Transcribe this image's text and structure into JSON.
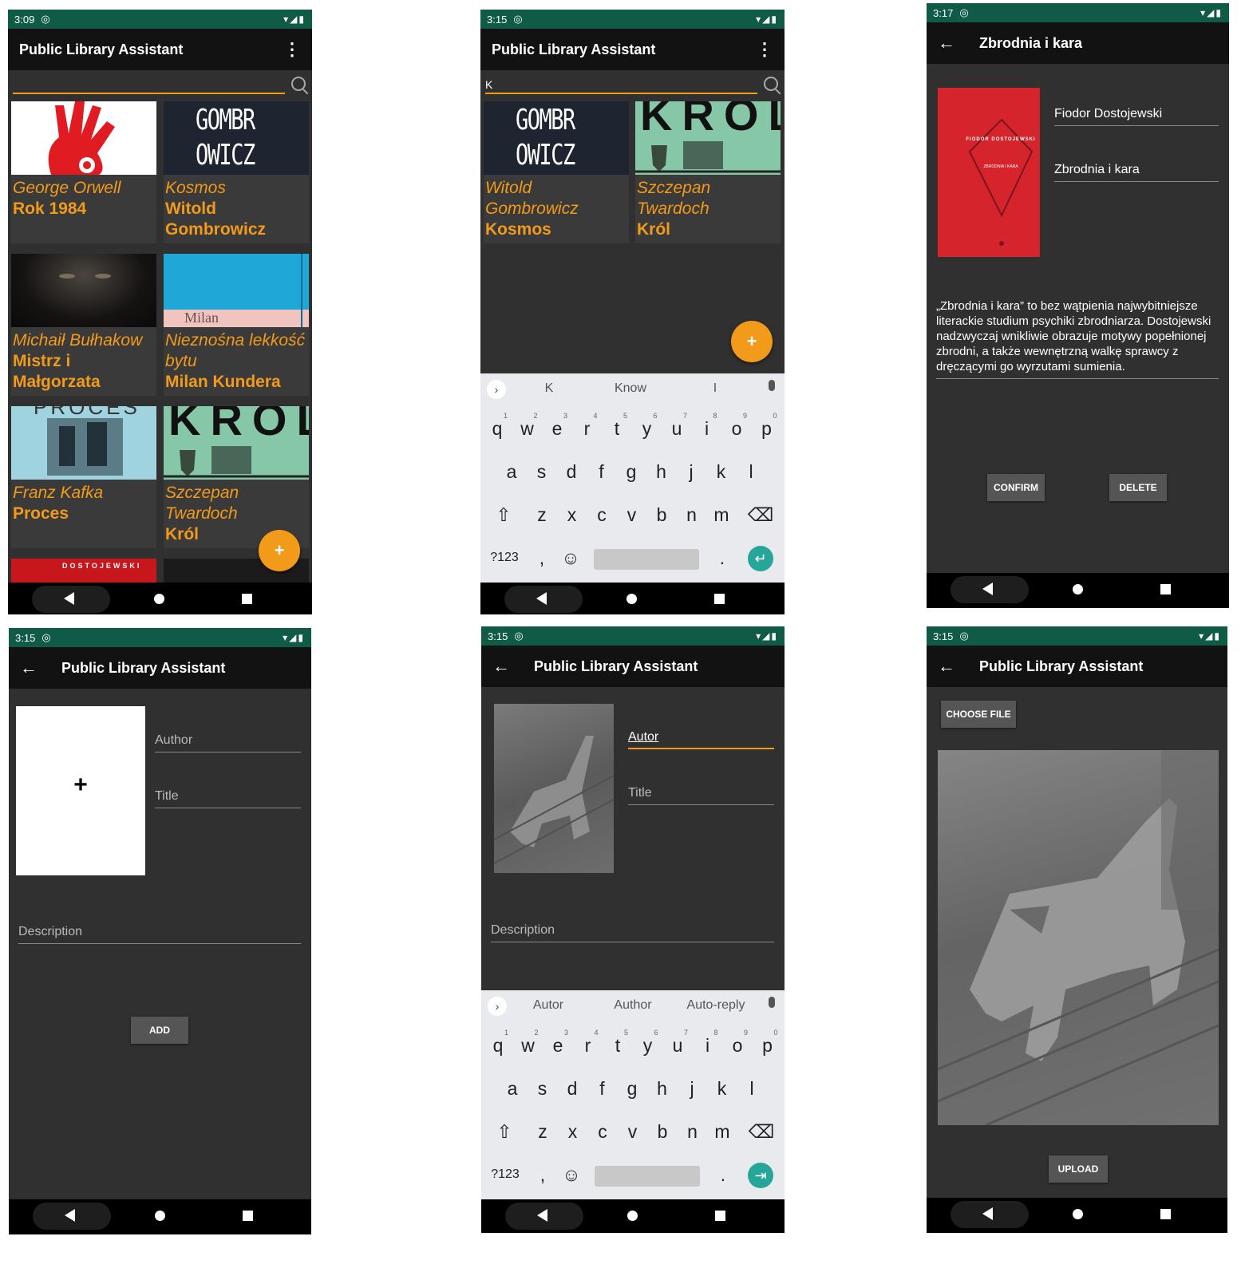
{
  "app_title": "Public Library Assistant",
  "nav": {
    "back": "◀",
    "home": "●",
    "recent": "■"
  },
  "screen1": {
    "time": "3:09",
    "books": [
      {
        "line1": "George Orwell",
        "line2": "Rok 1984"
      },
      {
        "line1": "Kosmos",
        "line2": "Witold Gombrowicz"
      },
      {
        "line1": "Michaił Bułhakow",
        "line2": "Mistrz i Małgorzata"
      },
      {
        "line1": "Nieznośna lekkość bytu",
        "line2": "Milan Kundera"
      },
      {
        "line1": "Franz Kafka",
        "line2": "Proces"
      },
      {
        "line1": "Szczepan Twardoch",
        "line2": "Król"
      }
    ],
    "covers": {
      "gombrowicz": "GOMBR OWICZ",
      "milan": "Milan",
      "krol": "KRÓL",
      "proces": "PROCES",
      "dostojewski": "DOSTOJEWSKI"
    },
    "fab": "+"
  },
  "screen2": {
    "time": "3:15",
    "search_value": "K",
    "books": [
      {
        "line1": "Witold Gombrowicz",
        "line2": "Kosmos"
      },
      {
        "line1": "Szczepan Twardoch",
        "line2": "Król"
      }
    ],
    "fab": "+",
    "suggestions": [
      "K",
      "Know",
      "I"
    ]
  },
  "keyboard": {
    "row1": [
      "q",
      "w",
      "e",
      "r",
      "t",
      "y",
      "u",
      "i",
      "o",
      "p"
    ],
    "row1_digits": [
      "1",
      "2",
      "3",
      "4",
      "5",
      "6",
      "7",
      "8",
      "9",
      "0"
    ],
    "row2": [
      "a",
      "s",
      "d",
      "f",
      "g",
      "h",
      "j",
      "k",
      "l"
    ],
    "row3": [
      "z",
      "x",
      "c",
      "v",
      "b",
      "n",
      "m"
    ],
    "shift": "⇧",
    "backspace": "⌫",
    "symbols": "?123",
    "comma": ",",
    "emoji": "☺",
    "period": ".",
    "enter_1": "↵",
    "enter_2": "⇥"
  },
  "screen3": {
    "time": "3:17",
    "title": "Zbrodnia i kara",
    "author": "Fiodor Dostojewski",
    "book_title": "Zbrodnia i kara",
    "description": "„Zbrodnia i kara” to bez wątpienia najwybitniejsze literackie studium psychiki zbrodniarza. Dostojewski nadzwyczaj wnikliwie obrazuje motywy popełnionej zbrodni, a także wewnętrzną walkę sprawcy z dręczącymi go wyrzutami sumienia.",
    "confirm": "CONFIRM",
    "delete": "DELETE",
    "cover_author": "FIODOR DOSTOJEWSKI",
    "cover_title": "ZBRODNIA I KARA"
  },
  "screen4": {
    "time": "3:15",
    "author_placeholder": "Author",
    "title_placeholder": "Title",
    "description_placeholder": "Description",
    "add_image": "+",
    "add": "ADD"
  },
  "screen5": {
    "time": "3:15",
    "author_value": "Autor",
    "title_placeholder": "Title",
    "description_placeholder": "Description",
    "suggestions": [
      "Autor",
      "Author",
      "Auto-reply"
    ]
  },
  "screen6": {
    "time": "3:15",
    "choose_file": "CHOOSE FILE",
    "upload": "UPLOAD"
  },
  "colors": {
    "accent": "#f29a1a",
    "status_bar": "#0f5b45",
    "app_bar": "#121212",
    "background": "#303030",
    "enter_key": "#26a69a"
  }
}
